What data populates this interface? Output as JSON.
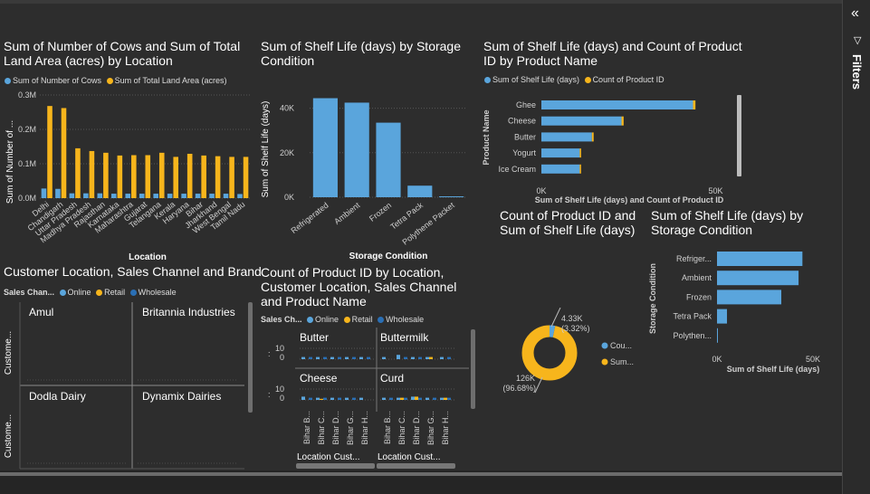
{
  "colors": {
    "blue": "#5aa5dc",
    "orange": "#f7b51c",
    "navy": "#2a6fb5",
    "bg": "#2d2d2d"
  },
  "filters_pane": {
    "label": "Filters",
    "collapse_icon": "double-chevron-left-icon",
    "filter_icon": "funnel-icon"
  },
  "v1": {
    "title": "Sum of Number of Cows and Sum of Total Land Area (acres) by Location",
    "legend": [
      "Sum of Number of Cows",
      "Sum of Total Land Area (acres)"
    ],
    "ylabel": "Sum of Number of ...",
    "xlabel": "Location",
    "yticks": [
      "0.0M",
      "0.1M",
      "0.2M",
      "0.3M"
    ]
  },
  "v2": {
    "title": "Sum of Shelf Life (days) by Storage Condition",
    "ylabel": "Sum of Shelf Life (days)",
    "xlabel": "Storage Condition",
    "yticks": [
      "0K",
      "20K",
      "40K"
    ]
  },
  "v3": {
    "title": "Sum of Shelf Life (days) and Count of Product ID by Product Name",
    "legend": [
      "Sum of Shelf Life (days)",
      "Count of Product ID"
    ],
    "ylabel": "Product Name",
    "xlabel": "Sum of Shelf Life (days) and Count of Product ID",
    "xticks": [
      "0K",
      "50K"
    ]
  },
  "v4": {
    "title": "Customer Location, Sales Channel and Brand",
    "legend_title": "Sales Chan...",
    "legend": [
      "Online",
      "Retail",
      "Wholesale"
    ],
    "row_label": "Custome...",
    "panels": [
      "Amul",
      "Britannia Industries",
      "Dodla Dairy",
      "Dynamix Dairies"
    ]
  },
  "v5": {
    "title": "Count of Product ID by Location, Customer Location, Sales Channel and Product Name",
    "legend_title": "Sales Ch...",
    "legend": [
      "Online",
      "Retail",
      "Wholesale"
    ],
    "panels": [
      "Butter",
      "Buttermilk",
      "Cheese",
      "Curd"
    ],
    "yticks": [
      "10",
      "0"
    ],
    "xticks": [
      "Bihar B...",
      "Bihar C...",
      "Bihar D...",
      "Bihar G...",
      "Bihar H..."
    ],
    "xlabel": "Location Cust..."
  },
  "v6": {
    "title": "Count of Product ID and Sum of Shelf Life (days)",
    "legend": [
      "Cou...",
      "Sum..."
    ],
    "label_small": "4.33K",
    "label_small_pct": "(3.32%)",
    "label_big": "126K",
    "label_big_pct": "(96.68%)"
  },
  "v7": {
    "title": "Sum of Shelf Life (days) by Storage Condition",
    "ylabel": "Storage Condition",
    "xlabel": "Sum of Shelf Life (days)",
    "xticks": [
      "0K",
      "50K"
    ]
  },
  "chart_data": [
    {
      "type": "bar",
      "categories": [
        "Delhi",
        "Chandigarh",
        "Uttar Pradesh",
        "Madhya Pradesh",
        "Rajasthan",
        "Karnataka",
        "Maharashtra",
        "Gujarat",
        "Telangana",
        "Kerala",
        "Haryana",
        "Bihar",
        "Jharkhand",
        "West Bengal",
        "Tamil Nadu"
      ],
      "series": [
        {
          "name": "Sum of Number of Cows",
          "values": [
            28000,
            27000,
            14000,
            14000,
            14000,
            13000,
            13000,
            13000,
            13000,
            13000,
            13000,
            13000,
            13000,
            13000,
            12000
          ]
        },
        {
          "name": "Sum of Total Land Area (acres)",
          "values": [
            268000,
            262000,
            145000,
            137000,
            132000,
            124000,
            125000,
            125000,
            132000,
            120000,
            129000,
            124000,
            122000,
            120000,
            120000
          ]
        }
      ],
      "title": "Sum of Number of Cows and Sum of Total Land Area (acres) by Location",
      "xlabel": "Location",
      "ylabel": "Sum of Number of ...",
      "ylim": [
        0,
        300000
      ],
      "grid": true,
      "legend": "top-left"
    },
    {
      "type": "bar",
      "categories": [
        "Refrigerated",
        "Ambient",
        "Frozen",
        "Tetra Pack",
        "Polythene Packet"
      ],
      "values": [
        44500,
        42500,
        33500,
        5200,
        400
      ],
      "title": "Sum of Shelf Life (days) by Storage Condition",
      "xlabel": "Storage Condition",
      "ylabel": "Sum of Shelf Life (days)",
      "ylim": [
        0,
        50000
      ],
      "grid": true
    },
    {
      "type": "bar",
      "orientation": "horizontal",
      "categories": [
        "Ghee",
        "Cheese",
        "Butter",
        "Yogurt",
        "Ice Cream"
      ],
      "series": [
        {
          "name": "Sum of Shelf Life (days)",
          "values": [
            43500,
            23000,
            14500,
            11000,
            11000
          ]
        },
        {
          "name": "Count of Product ID",
          "values": [
            700,
            600,
            500,
            400,
            300
          ]
        }
      ],
      "title": "Sum of Shelf Life (days) and Count of Product ID by Product Name",
      "xlabel": "Sum of Shelf Life (days) and Count of Product ID",
      "ylabel": "Product Name",
      "xlim": [
        0,
        60000
      ],
      "legend": "top-left"
    },
    {
      "type": "bar",
      "title": "Count of Product ID by Location, Customer Location, Sales Channel and Product Name",
      "panels": [
        "Butter",
        "Buttermilk",
        "Cheese",
        "Curd"
      ],
      "categories": [
        "Bihar B...",
        "Bihar C...",
        "Bihar D...",
        "Bihar G...",
        "Bihar H..."
      ],
      "series": [
        {
          "name": "Online",
          "values": [
            [
              2,
              2,
              2,
              2,
              2
            ],
            [
              2,
              4,
              2,
              2,
              2
            ],
            [
              3,
              2,
              2,
              2,
              2
            ],
            [
              2,
              2,
              3,
              2,
              2
            ]
          ]
        },
        {
          "name": "Retail",
          "values": [
            [
              0,
              0,
              0,
              0,
              0
            ],
            [
              0,
              0,
              0,
              2,
              0
            ],
            [
              0,
              1,
              0,
              0,
              0
            ],
            [
              0,
              2,
              3,
              0,
              2
            ]
          ]
        },
        {
          "name": "Wholesale",
          "values": [
            [
              2,
              2,
              2,
              2,
              2
            ],
            [
              0,
              2,
              2,
              0,
              2
            ],
            [
              2,
              2,
              2,
              2,
              0
            ],
            [
              2,
              2,
              2,
              2,
              2
            ]
          ]
        }
      ],
      "ylim": [
        0,
        10
      ],
      "legend": "top-left"
    },
    {
      "type": "pie",
      "donut": true,
      "labels": [
        "Count of Product ID",
        "Sum of Shelf Life (days)"
      ],
      "values": [
        4330,
        126000
      ],
      "percent": [
        3.32,
        96.68
      ],
      "title": "Count of Product ID and Sum of Shelf Life (days)",
      "legend": "right"
    },
    {
      "type": "bar",
      "orientation": "horizontal",
      "categories": [
        "Refriger...",
        "Ambient",
        "Frozen",
        "Tetra Pack",
        "Polythen..."
      ],
      "values": [
        44500,
        42500,
        33500,
        5200,
        400
      ],
      "title": "Sum of Shelf Life (days) by Storage Condition",
      "xlabel": "Sum of Shelf Life (days)",
      "ylabel": "Storage Condition",
      "xlim": [
        0,
        50000
      ]
    }
  ]
}
